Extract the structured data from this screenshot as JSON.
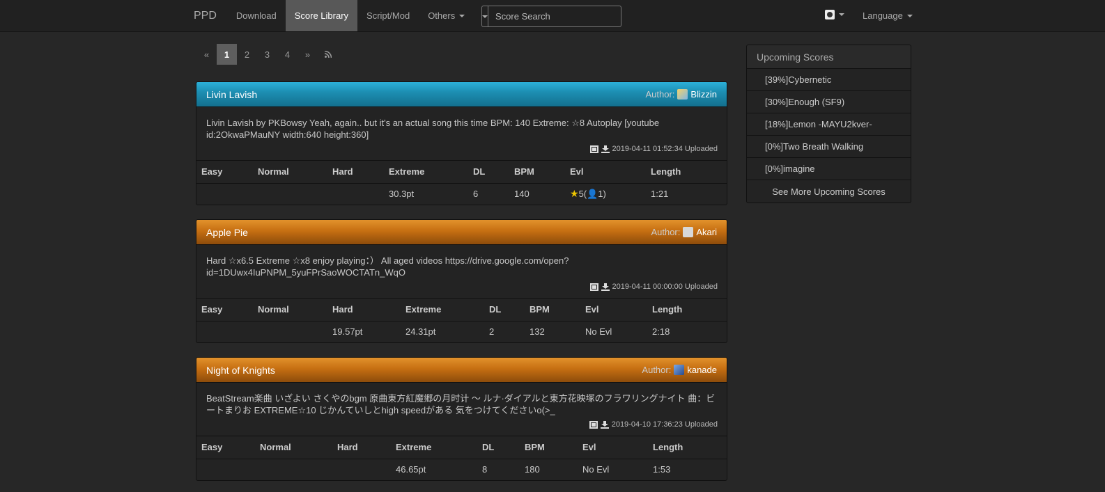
{
  "nav": {
    "brand": "PPD",
    "links": [
      "Download",
      "Score Library",
      "Script/Mod",
      "Others"
    ],
    "active_index": 1,
    "search_placeholder": "Score Search",
    "language": "Language"
  },
  "pagination": {
    "prev": "«",
    "pages": [
      "1",
      "2",
      "3",
      "4"
    ],
    "active": "1",
    "next": "»"
  },
  "scores": [
    {
      "title": "Livin Lavish",
      "theme": "blue",
      "author_label": "Author:",
      "author": "Blizzin",
      "description": "Livin Lavish by PKBowsy Yeah, again.. but it's an actual song this time BPM: 140 Extreme: ☆8 Autoplay [youtube id:2OkwaPMauNY width:640 height:360]",
      "timestamp": "2019-04-11 01:52:34 Uploaded",
      "headers": [
        "Easy",
        "Normal",
        "Hard",
        "Extreme",
        "DL",
        "BPM",
        "Evl",
        "Length"
      ],
      "row": [
        "",
        "",
        "",
        "30.3pt",
        "6",
        "140",
        "★5(👤1)",
        "1:21"
      ]
    },
    {
      "title": "Apple Pie",
      "theme": "orange",
      "author_label": "Author:",
      "author": "Akari",
      "description": "Hard ☆x6.5 Extreme ☆x8 enjoy playing：） All aged videos https://drive.google.com/open?id=1DUwx4IuPNPM_5yuFPrSaoWOCTATn_WqO",
      "timestamp": "2019-04-11 00:00:00 Uploaded",
      "headers": [
        "Easy",
        "Normal",
        "Hard",
        "Extreme",
        "DL",
        "BPM",
        "Evl",
        "Length"
      ],
      "row": [
        "",
        "",
        "19.57pt",
        "24.31pt",
        "2",
        "132",
        "No Evl",
        "2:18"
      ]
    },
    {
      "title": "Night of Knights",
      "theme": "orange",
      "author_label": "Author:",
      "author": "kanade",
      "description": "BeatStream楽曲 いざよい さくやのbgm 原曲東方紅魔郷の月时计 ～ ルナ·ダイアルと東方花映塚のフラワリングナイト 曲：ビートまりお EXTREME☆10 じかんていしとhigh speedがある 気をつけてくださいo(>_",
      "timestamp": "2019-04-10 17:36:23 Uploaded",
      "headers": [
        "Easy",
        "Normal",
        "Hard",
        "Extreme",
        "DL",
        "BPM",
        "Evl",
        "Length"
      ],
      "row": [
        "",
        "",
        "",
        "46.65pt",
        "8",
        "180",
        "No Evl",
        "1:53"
      ]
    }
  ],
  "upcoming": {
    "title": "Upcoming Scores",
    "items": [
      "[39%]Cybernetic",
      "[30%]Enough (SF9)",
      "[18%]Lemon -MAYU2kver-",
      "[0%]Two Breath Walking",
      "[0%]imagine"
    ],
    "more": "See More Upcoming Scores"
  }
}
